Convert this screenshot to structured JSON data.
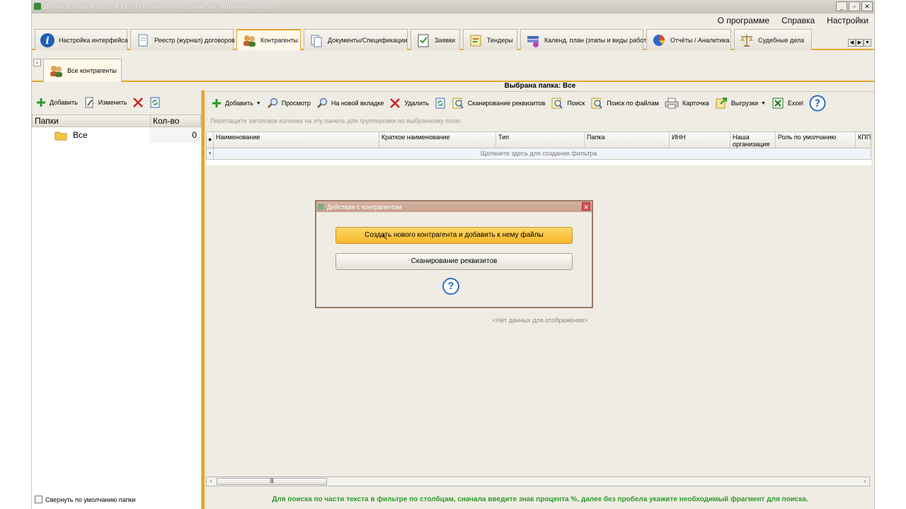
{
  "window": {
    "title": "Договор Партнер 2024 v17.0 Полная . Пользователь : Администратор"
  },
  "menu": [
    "О программе",
    "Справка",
    "Настройки"
  ],
  "tabs": [
    {
      "label": "Настройка интерфейса",
      "icon": "info-icon"
    },
    {
      "label": "Реестр (журнал) договоров",
      "icon": "document-icon"
    },
    {
      "label": "Контрагенты",
      "icon": "users-icon",
      "active": true
    },
    {
      "label": "Документы/Спецификации",
      "icon": "documents-icon"
    },
    {
      "label": "Заявки",
      "icon": "checklist-icon"
    },
    {
      "label": "Тендеры",
      "icon": "tender-icon"
    },
    {
      "label": "Календ. план (этапы и виды работ)",
      "icon": "calendar-icon"
    },
    {
      "label": "Отчёты / Аналитика",
      "icon": "pie-chart-icon"
    },
    {
      "label": "Судебные дела",
      "icon": "scales-icon"
    }
  ],
  "subtab": {
    "label": "Все контрагенты"
  },
  "left": {
    "toolbar": {
      "add": "Добавить",
      "edit": "Изменить"
    },
    "columns": {
      "folders": "Папки",
      "count": "Кол-во"
    },
    "rows": [
      {
        "name": "Все",
        "count": "0"
      }
    ],
    "collapse_label": "Свернуть по умолчанию папки"
  },
  "right": {
    "selected_folder": "Выбрана папка: Все",
    "toolbar": {
      "add": "Добавить",
      "view": "Просмотр",
      "new_tab": "На новой вкладке",
      "delete": "Удалить",
      "scan": "Сканирование реквизитов",
      "search": "Поиск",
      "file_search": "Поиск по файлам",
      "card": "Карточка",
      "export": "Выгрузки",
      "excel": "Excel"
    },
    "group_hint": "Перетащите заголовок колонки на эту панель для группировки по выбранному полю",
    "columns": [
      "Наименование",
      "Краткое наименование",
      "Тип",
      "Папка",
      "ИНН",
      "Наша организация",
      "Роль по умолчанию",
      "КПП"
    ],
    "filter_hint": "Щелкните здесь для создания фильтра",
    "no_data": "<Нет данных для отображения>",
    "search_hint": "Для поиска по части текста в фильтре по столбцам, сначала введите знак процента %, далее без пробела укажите необходимый фрагмент для поиска."
  },
  "dialog": {
    "title": "Действия с контрагентом",
    "create_label": "Создать нового контрагента и добавить к нему файлы",
    "scan_label": "Сканирование реквизитов",
    "help": "?"
  }
}
